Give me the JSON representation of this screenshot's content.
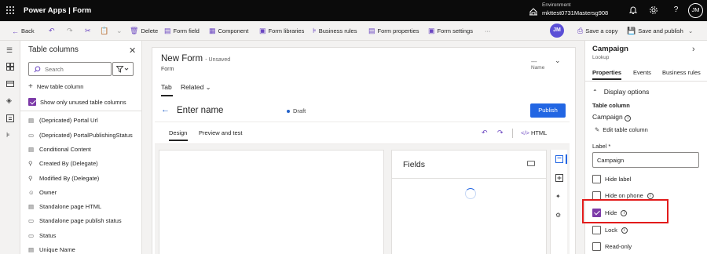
{
  "topbar": {
    "app_title": "Power Apps  |  Form",
    "env_label": "Environment",
    "env_value": "mkttest0731Mastersg908",
    "user_initials": "JM"
  },
  "commandbar": {
    "back": "Back",
    "delete": "Delete",
    "form_field": "Form field",
    "component": "Component",
    "form_libraries": "Form libraries",
    "business_rules": "Business rules",
    "form_properties": "Form properties",
    "form_settings": "Form settings",
    "more": "···",
    "user_initials": "JM",
    "save_copy": "Save a copy",
    "save_publish": "Save and publish"
  },
  "table_columns": {
    "title": "Table columns",
    "search_placeholder": "Search",
    "new_column": "New table column",
    "show_unused": "Show only unused table columns",
    "items": [
      {
        "label": "(Depricated) Portal Url",
        "icon": "text-field-icon"
      },
      {
        "label": "(Depricated) PortalPublishingStatus",
        "icon": "option-set-icon"
      },
      {
        "label": "Conditional Content",
        "icon": "multiline-text-icon"
      },
      {
        "label": "Created By (Delegate)",
        "icon": "lookup-icon"
      },
      {
        "label": "Modified By (Delegate)",
        "icon": "lookup-icon"
      },
      {
        "label": "Owner",
        "icon": "owner-icon"
      },
      {
        "label": "Standalone page HTML",
        "icon": "multiline-text-icon"
      },
      {
        "label": "Standalone page publish status",
        "icon": "option-set-icon"
      },
      {
        "label": "Status",
        "icon": "option-set-icon"
      },
      {
        "label": "Unique Name",
        "icon": "text-field-icon"
      }
    ]
  },
  "form": {
    "title": "New Form",
    "unsaved": "- Unsaved",
    "subtitle": "Form",
    "header_dash": "---",
    "header_name": "Name",
    "tab_active": "Tab",
    "tab_related": "Related",
    "entry_name": "Enter name",
    "draft": "Draft",
    "publish": "Publish",
    "design_tab": "Design",
    "preview_tab": "Preview and test",
    "html_btn": "HTML",
    "fields_title": "Fields"
  },
  "properties": {
    "title": "Campaign",
    "subtitle": "Lookup",
    "tabs": [
      "Properties",
      "Events",
      "Business rules"
    ],
    "display_options": "Display options",
    "table_column_label": "Table column",
    "table_column_value": "Campaign",
    "edit_column": "Edit table column",
    "label_label": "Label *",
    "label_value": "Campaign",
    "checkboxes": [
      {
        "label": "Hide label",
        "checked": false,
        "info": false
      },
      {
        "label": "Hide on phone",
        "checked": false,
        "info": true
      },
      {
        "label": "Hide",
        "checked": true,
        "info": true
      },
      {
        "label": "Lock",
        "checked": false,
        "info": true
      },
      {
        "label": "Read-only",
        "checked": false,
        "info": false
      }
    ]
  },
  "colors": {
    "accent": "#2266e3",
    "brand_purple": "#6b46c1",
    "highlight_red": "#e21b1b"
  }
}
